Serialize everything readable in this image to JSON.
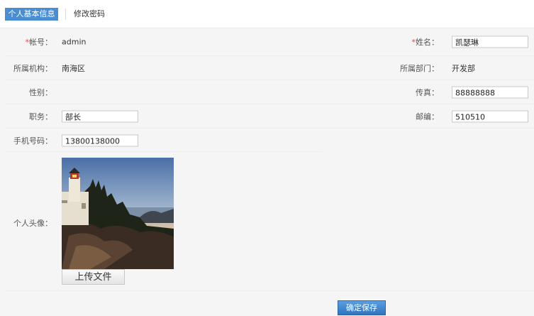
{
  "tabs": {
    "active": "个人基本信息",
    "inactive": "修改密码"
  },
  "form": {
    "account": {
      "label": "帐号：",
      "required_mark": "*",
      "value": "admin"
    },
    "name": {
      "label": "姓名：",
      "required_mark": "*",
      "value": "凯瑟琳"
    },
    "org": {
      "label": "所属机构：",
      "value": "南海区"
    },
    "dept": {
      "label": "所属部门：",
      "value": "开发部"
    },
    "gender": {
      "label": "性别：",
      "value": ""
    },
    "fax": {
      "label": "传真：",
      "value": "88888888"
    },
    "position": {
      "label": "职务：",
      "value": "部长"
    },
    "zip": {
      "label": "邮编：",
      "value": "510510"
    },
    "mobile": {
      "label": "手机号码：",
      "value": "13800138000"
    },
    "avatar": {
      "label": "个人头像：",
      "upload_label": "上传文件"
    }
  },
  "actions": {
    "save_label": "确定保存"
  },
  "colors": {
    "accent": "#4a8ed1",
    "required": "#e04848",
    "button": "#2e74bf"
  }
}
